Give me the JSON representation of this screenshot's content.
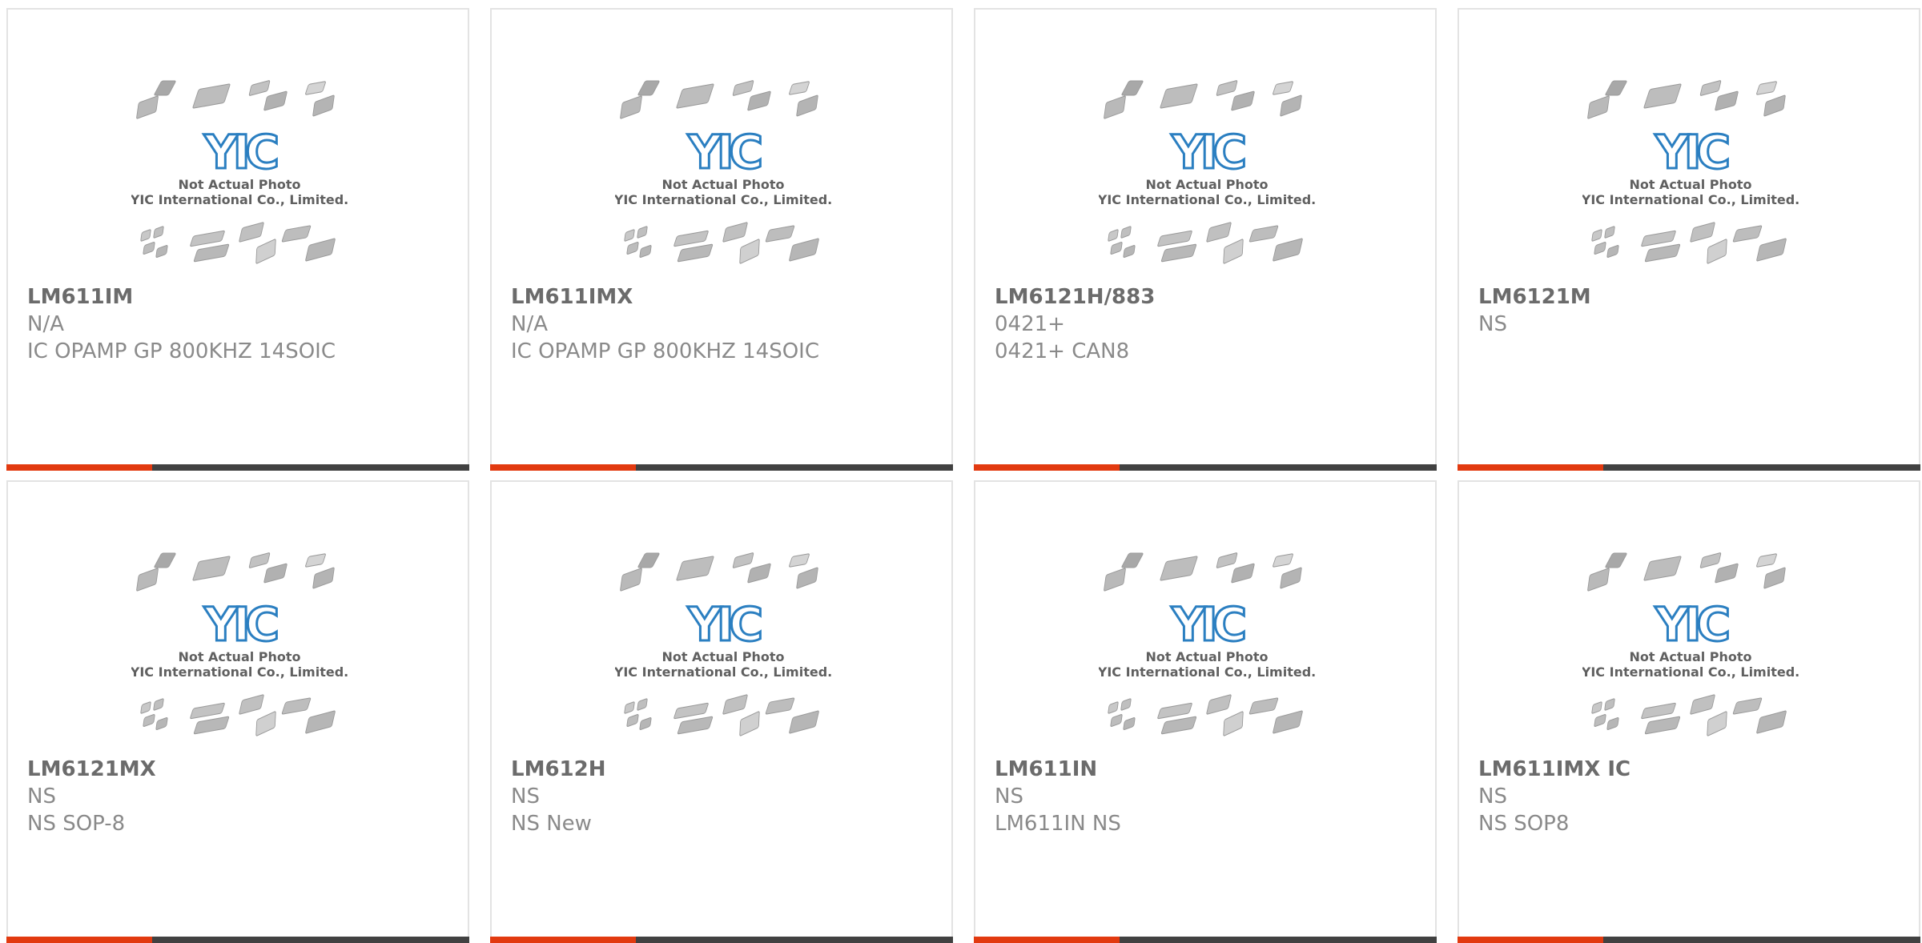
{
  "colors": {
    "accent": "#e23a10",
    "bar": "#414141",
    "logo_blue": "#2b7fc1",
    "text_dark": "#6b6b6b",
    "text_light": "#8a8a8a"
  },
  "placeholder": {
    "logo_text": "YIC",
    "caption_line1": "Not Actual Photo",
    "caption_line2": "YIC International Co., Limited."
  },
  "products": [
    {
      "part": "LM611IM",
      "manufacturer": "N/A",
      "description": "IC OPAMP GP 800KHZ 14SOIC"
    },
    {
      "part": "LM611IMX",
      "manufacturer": "N/A",
      "description": "IC OPAMP GP 800KHZ 14SOIC"
    },
    {
      "part": "LM6121H/883",
      "manufacturer": "0421+",
      "description": "0421+ CAN8"
    },
    {
      "part": "LM6121M",
      "manufacturer": "NS",
      "description": ""
    },
    {
      "part": "LM6121MX",
      "manufacturer": "NS",
      "description": "NS SOP-8"
    },
    {
      "part": "LM612H",
      "manufacturer": "NS",
      "description": "NS New"
    },
    {
      "part": "LM611IN",
      "manufacturer": "NS",
      "description": "LM611IN NS"
    },
    {
      "part": "LM611IMX IC",
      "manufacturer": "NS",
      "description": "NS SOP8"
    }
  ]
}
